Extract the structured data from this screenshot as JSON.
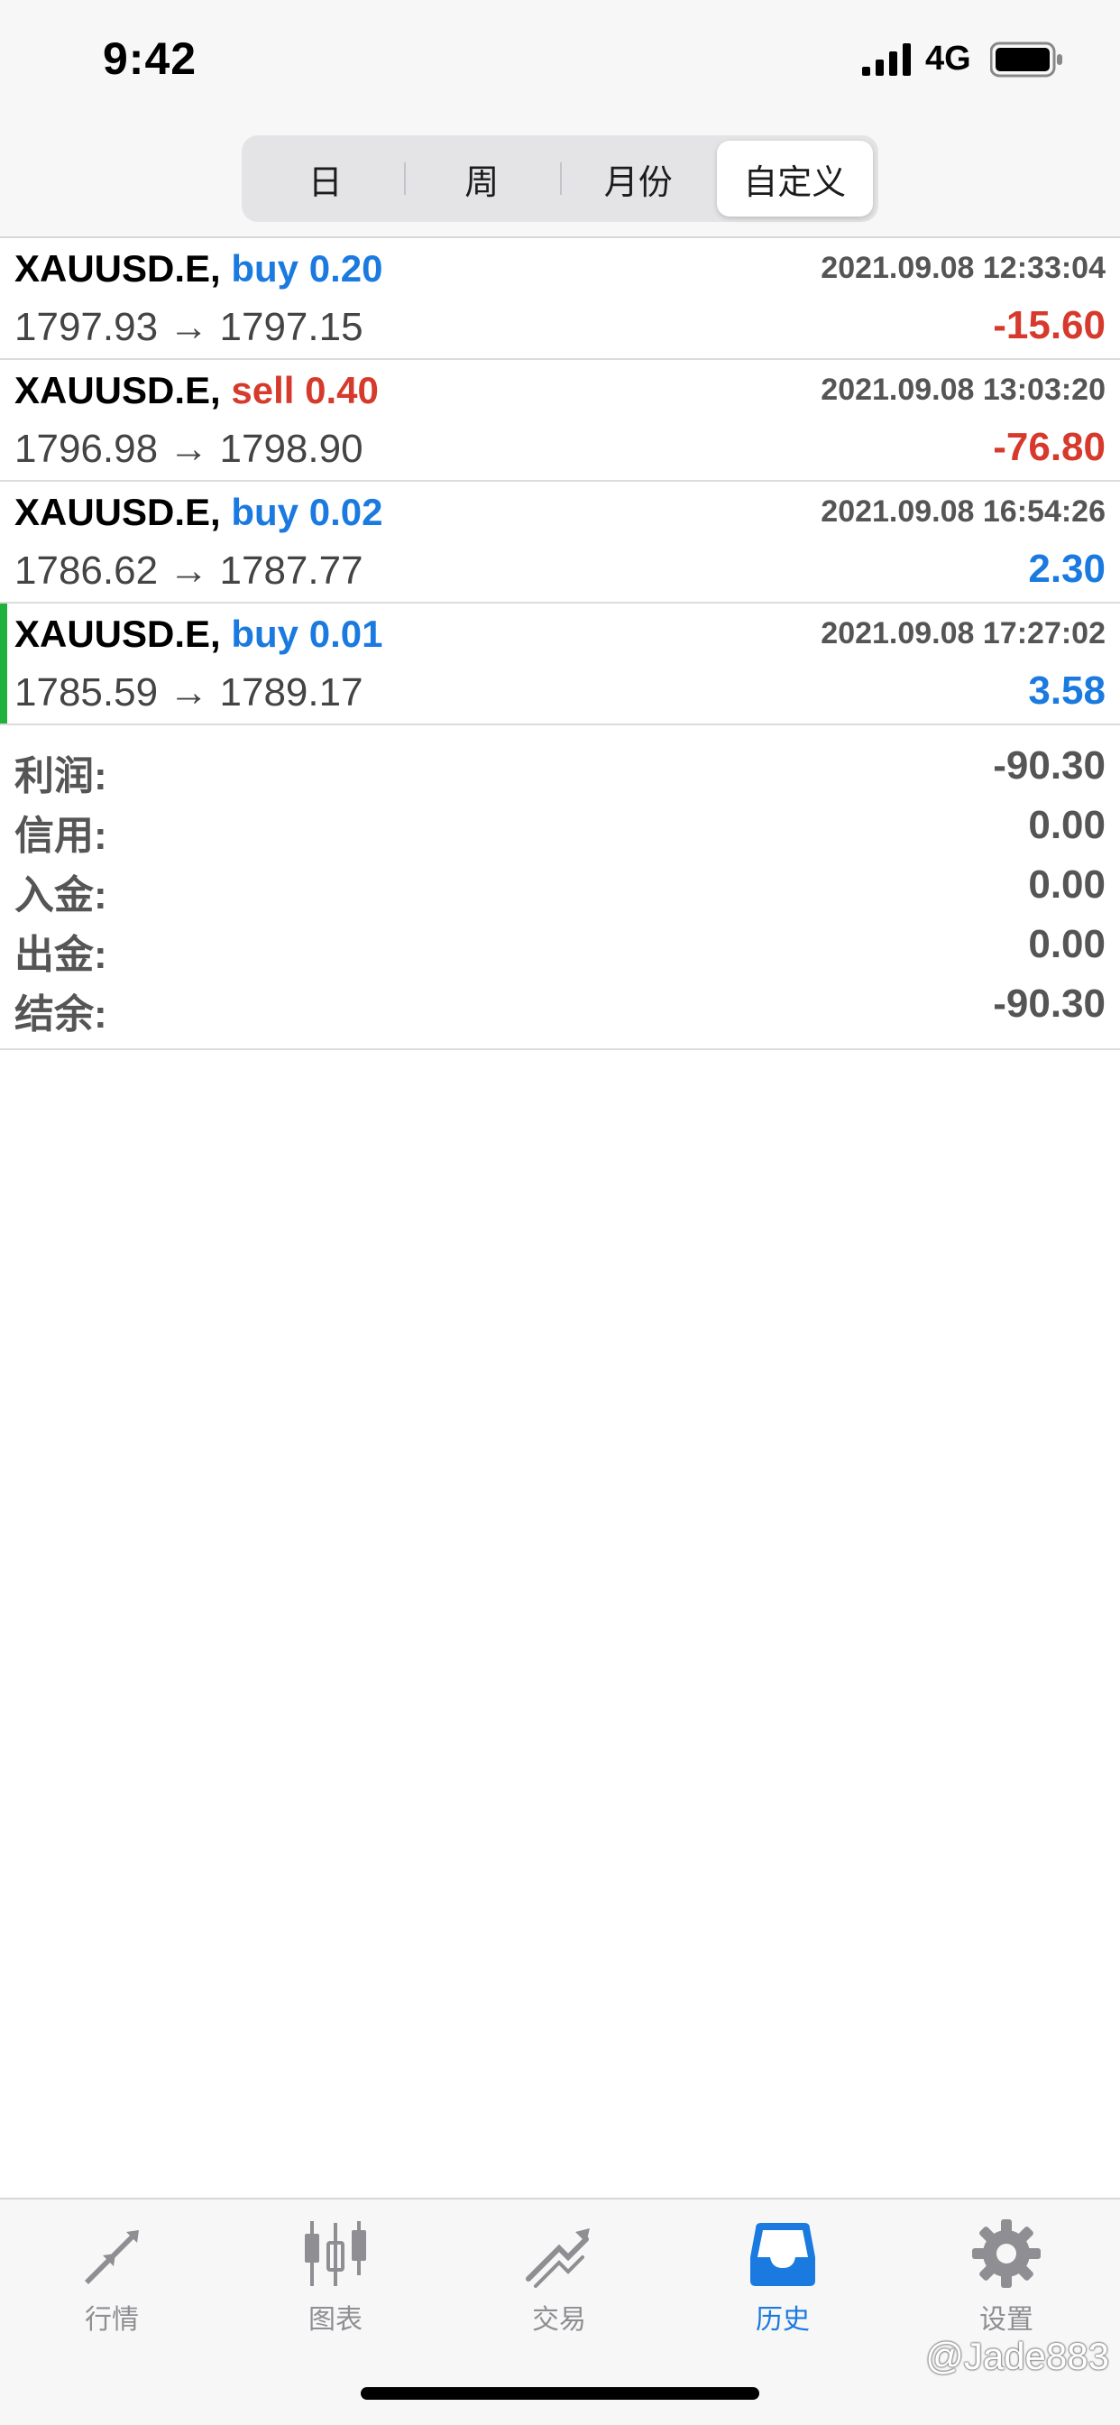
{
  "status_bar": {
    "time": "9:42",
    "network": "4G"
  },
  "period_tabs": [
    {
      "label": "日",
      "active": false
    },
    {
      "label": "周",
      "active": false
    },
    {
      "label": "月份",
      "active": false
    },
    {
      "label": "自定义",
      "active": true
    }
  ],
  "trades": [
    {
      "symbol": "XAUUSD.E,",
      "side": "buy 0.20",
      "side_type": "buy",
      "time": "2021.09.08 12:33:04",
      "prices": "1797.93 → 1797.15",
      "profit": "-15.60",
      "profit_sign": "neg"
    },
    {
      "symbol": "XAUUSD.E,",
      "side": "sell 0.40",
      "side_type": "sell",
      "time": "2021.09.08 13:03:20",
      "prices": "1796.98 → 1798.90",
      "profit": "-76.80",
      "profit_sign": "neg"
    },
    {
      "symbol": "XAUUSD.E,",
      "side": "buy 0.02",
      "side_type": "buy",
      "time": "2021.09.08 16:54:26",
      "prices": "1786.62 → 1787.77",
      "profit": "2.30",
      "profit_sign": "pos"
    },
    {
      "symbol": "XAUUSD.E,",
      "side": "buy 0.01",
      "side_type": "buy",
      "time": "2021.09.08 17:27:02",
      "prices": "1785.59 → 1789.17",
      "profit": "3.58",
      "profit_sign": "pos"
    }
  ],
  "summary": [
    {
      "label": "利润:",
      "value": "-90.30"
    },
    {
      "label": "信用:",
      "value": "0.00"
    },
    {
      "label": "入金:",
      "value": "0.00"
    },
    {
      "label": "出金:",
      "value": "0.00"
    },
    {
      "label": "结余:",
      "value": "-90.30"
    }
  ],
  "tabbar": [
    {
      "label": "行情",
      "icon": "quotes-arrows-icon",
      "active": false
    },
    {
      "label": "图表",
      "icon": "candlestick-chart-icon",
      "active": false
    },
    {
      "label": "交易",
      "icon": "trade-chart-icon",
      "active": false
    },
    {
      "label": "历史",
      "icon": "history-inbox-icon",
      "active": true
    },
    {
      "label": "设置",
      "icon": "gear-icon",
      "active": false
    }
  ],
  "watermark": "@Jade883",
  "colors": {
    "buy": "#1a7ae0",
    "sell": "#d63a2c",
    "selected_marker": "#1fb13b",
    "tab_active": "#1a7ae0",
    "tab_inactive": "#8e8e93"
  }
}
